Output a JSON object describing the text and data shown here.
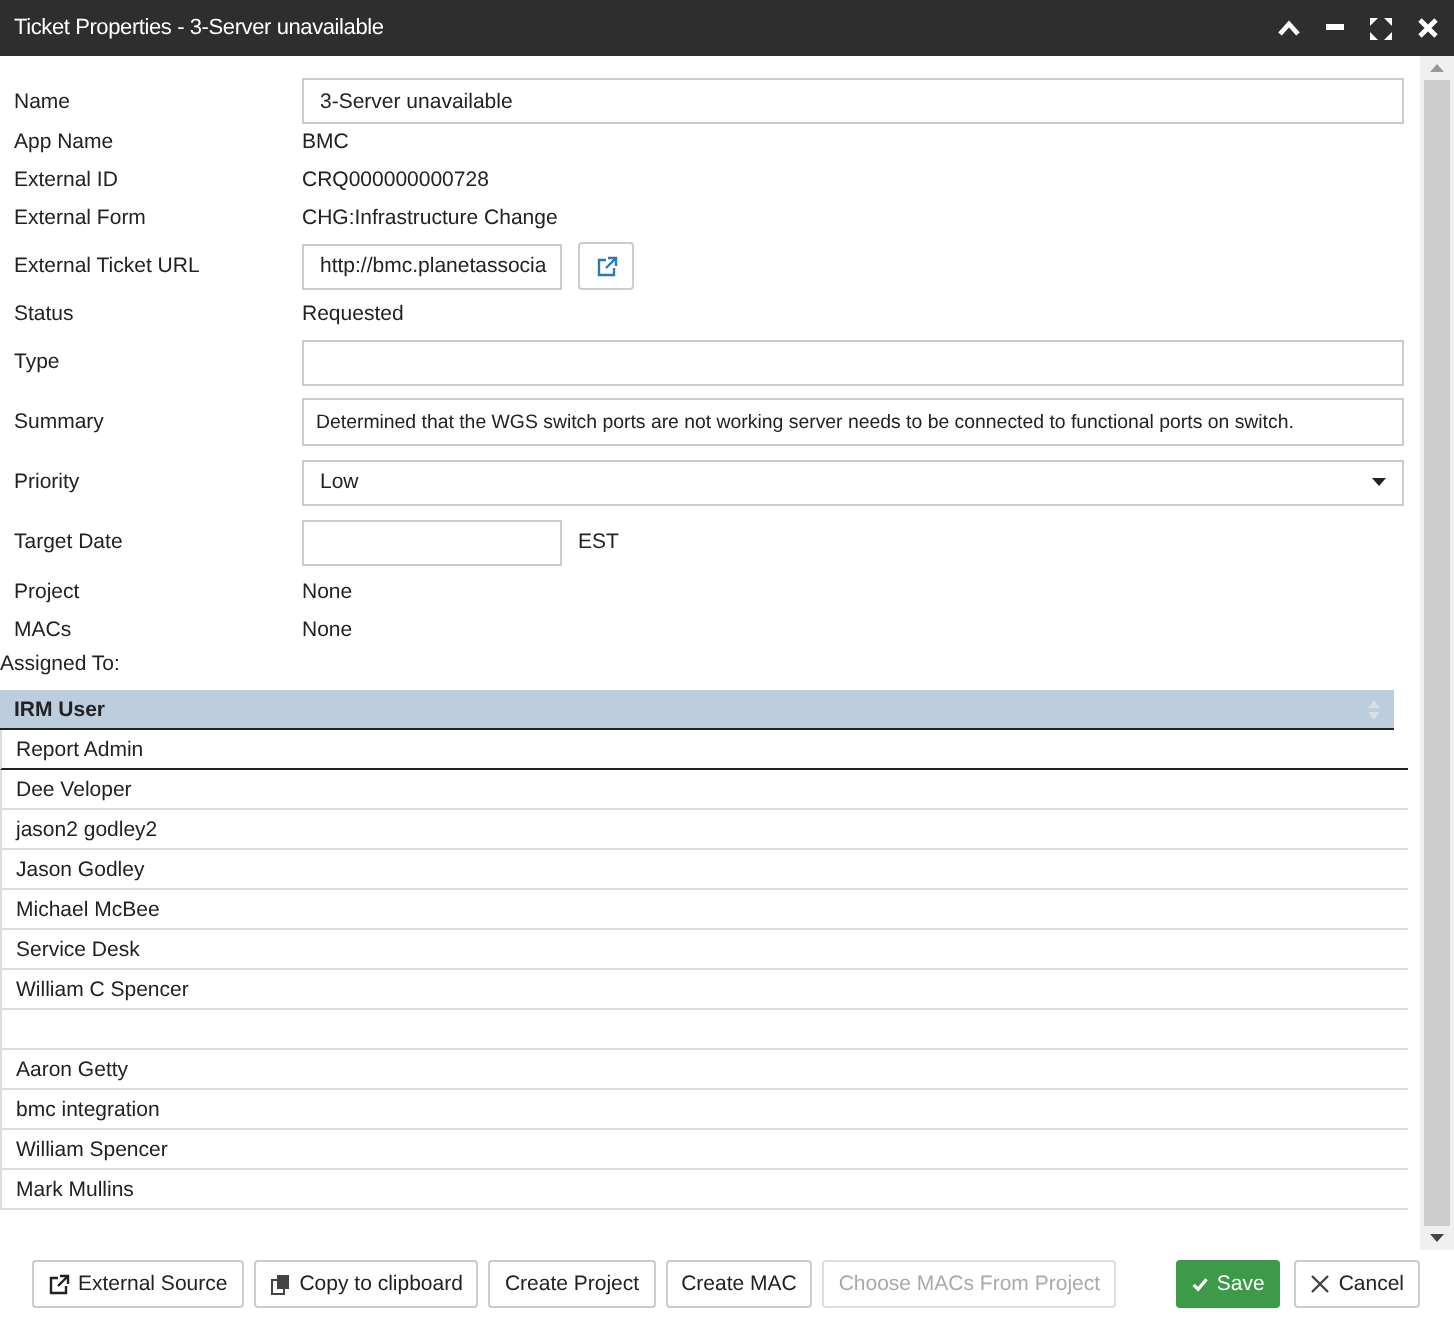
{
  "window": {
    "title": "Ticket Properties - 3-Server unavailable"
  },
  "fields": [
    {
      "kind": "input",
      "label": "Name",
      "value": "3-Server unavailable"
    },
    {
      "kind": "text",
      "label": "App Name",
      "value": "BMC"
    },
    {
      "kind": "text",
      "label": "External ID",
      "value": "CRQ000000000728"
    },
    {
      "kind": "text",
      "label": "External Form",
      "value": "CHG:Infrastructure Change"
    },
    {
      "kind": "link",
      "label": "External Ticket URL",
      "value": "http://bmc.planetassocia"
    },
    {
      "kind": "text",
      "label": "Status",
      "value": "Requested"
    },
    {
      "kind": "input",
      "label": "Type"
    },
    {
      "kind": "input",
      "label": "Summary",
      "value": "Determined that the WGS switch ports are not working server needs to be connected to functional ports on switch."
    },
    {
      "kind": "select",
      "label": "Priority",
      "value": "Low"
    },
    {
      "kind": "date",
      "label": "Target Date",
      "suffix": "EST"
    },
    {
      "kind": "text",
      "label": "Project",
      "value": "None"
    },
    {
      "kind": "text",
      "label": "MACs",
      "value": "None"
    }
  ],
  "assigned_label": "Assigned To:",
  "table": {
    "column": "IRM User",
    "rows": [
      {
        "kind": "user",
        "name": "Report Admin",
        "selected": true
      },
      {
        "kind": "user",
        "name": "Dee Veloper",
        "selected": false
      },
      {
        "kind": "user",
        "name": "jason2 godley2",
        "selected": false
      },
      {
        "kind": "user",
        "name": "Jason Godley",
        "selected": false
      },
      {
        "kind": "user",
        "name": "Michael McBee",
        "selected": false
      },
      {
        "kind": "user",
        "name": "Service Desk",
        "selected": false
      },
      {
        "kind": "user",
        "name": "William C Spencer",
        "selected": false
      },
      {
        "kind": "blank",
        "selected": false
      },
      {
        "kind": "user",
        "name": "Aaron Getty",
        "selected": false
      },
      {
        "kind": "user",
        "name": "bmc integration",
        "selected": false
      },
      {
        "kind": "user",
        "name": "William Spencer",
        "selected": false
      },
      {
        "kind": "user",
        "name": "Mark Mullins",
        "selected": false
      }
    ]
  },
  "buttons": [
    {
      "kind": "external",
      "label": "External Source",
      "disabled": false
    },
    {
      "kind": "copy",
      "label": "Copy to clipboard",
      "disabled": false
    },
    {
      "kind": "plain",
      "label": "Create Project",
      "disabled": false
    },
    {
      "kind": "plain",
      "label": "Create MAC",
      "disabled": false
    },
    {
      "kind": "plain",
      "label": "Choose MACs From Project",
      "disabled": true
    },
    {
      "kind": "save",
      "label": "Save",
      "disabled": false
    },
    {
      "kind": "cancel",
      "label": "Cancel",
      "disabled": false
    }
  ]
}
